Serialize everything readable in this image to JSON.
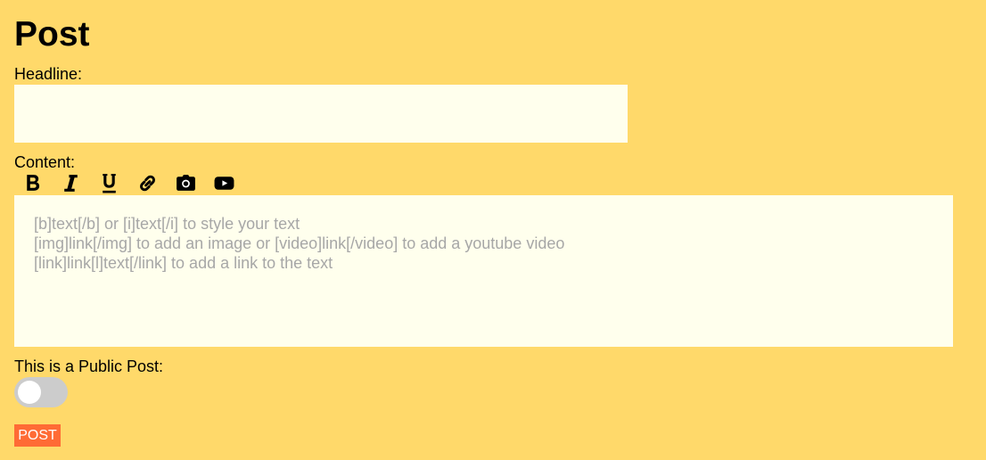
{
  "page": {
    "title": "Post"
  },
  "headline": {
    "label": "Headline:",
    "value": "",
    "placeholder": ""
  },
  "content": {
    "label": "Content:",
    "value": "",
    "placeholder": "[b]text[/b] or [i]text[/i] to style your text\n[img]link[/img] to add an image or [video]link[/video] to add a youtube video\n[link]link[l]text[/link] to add a link to the text"
  },
  "toolbar": {
    "tools": [
      {
        "icon": "bold-icon"
      },
      {
        "icon": "italic-icon"
      },
      {
        "icon": "underline-icon"
      },
      {
        "icon": "link-icon"
      },
      {
        "icon": "camera-icon"
      },
      {
        "icon": "youtube-icon"
      }
    ]
  },
  "public_post": {
    "label": "This is a Public Post:",
    "enabled": false
  },
  "post_button": {
    "label": "POST"
  },
  "colors": {
    "background": "#ffd96a",
    "field_background": "#ffffed",
    "placeholder_text": "#a7a7a7",
    "toggle_off": "#cccccc",
    "post_button": "#ff6b35"
  }
}
